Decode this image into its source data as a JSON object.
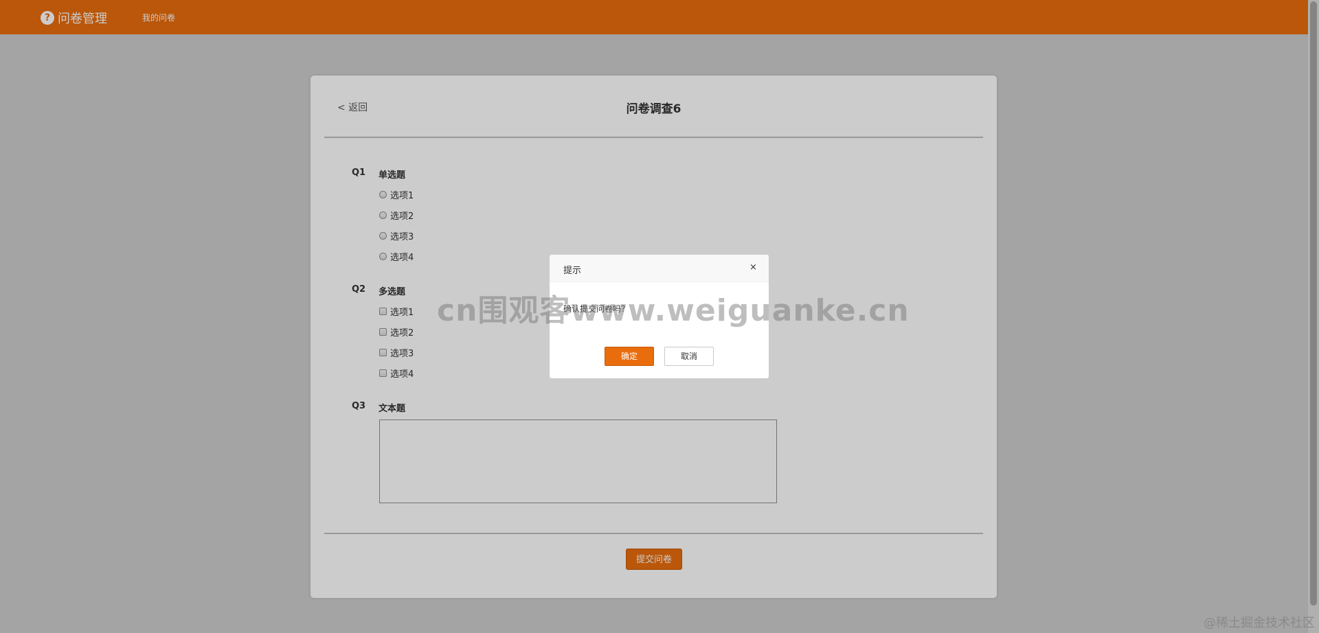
{
  "topbar": {
    "logo_icon": "?",
    "logo_text": "问卷管理",
    "nav_my": "我的问卷",
    "color": "#e96d0d"
  },
  "survey": {
    "back_label": "< 返回",
    "title": "问卷调查6",
    "questions": [
      {
        "num": "Q1",
        "title": "单选题",
        "options": [
          "选项1",
          "选项2",
          "选项3",
          "选项4"
        ]
      },
      {
        "num": "Q2",
        "title": "多选题",
        "options": [
          "选项1",
          "选项2",
          "选项3",
          "选项4"
        ]
      },
      {
        "num": "Q3",
        "title": "文本题",
        "value": ""
      }
    ],
    "submit_label": "提交问卷"
  },
  "dialog": {
    "title": "提示",
    "close_icon": "×",
    "message": "确认提交问卷吗？",
    "ok_label": "确定",
    "cancel_label": "取消"
  },
  "watermarks": {
    "center": "cn围观客www.weiguanke.cn",
    "corner": "@稀土掘金技术社区"
  }
}
